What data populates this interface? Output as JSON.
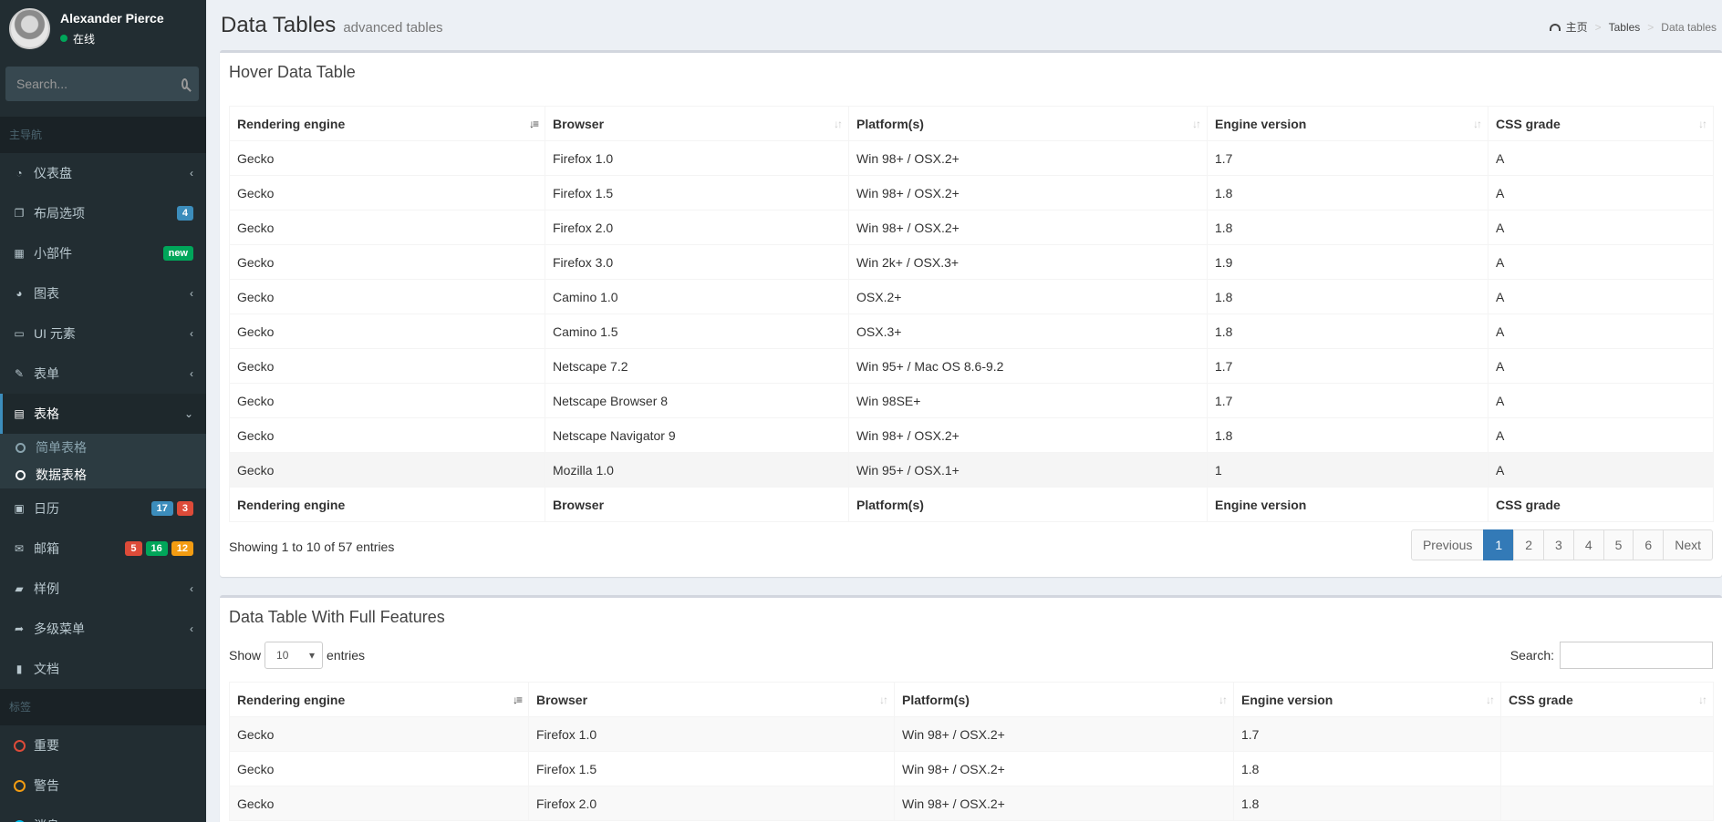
{
  "user": {
    "name": "Alexander Pierce",
    "status": "在线"
  },
  "sidebar": {
    "search_placeholder": "Search...",
    "header_main": "主导航",
    "header_labels": "标签",
    "items": [
      {
        "label": "仪表盘",
        "icon": "dashboard-icon"
      },
      {
        "label": "布局选项",
        "icon": "files-icon",
        "badges": [
          "4"
        ]
      },
      {
        "label": "小部件",
        "icon": "grid-icon",
        "badges": [
          "new"
        ]
      },
      {
        "label": "图表",
        "icon": "pie-chart-icon"
      },
      {
        "label": "UI 元素",
        "icon": "laptop-icon"
      },
      {
        "label": "表单",
        "icon": "edit-icon"
      },
      {
        "label": "表格",
        "icon": "table-icon"
      },
      {
        "label": "日历",
        "icon": "calendar-icon",
        "badges": [
          "17",
          "3"
        ]
      },
      {
        "label": "邮箱",
        "icon": "envelope-icon",
        "badges": [
          "5",
          "16",
          "12"
        ]
      },
      {
        "label": "样例",
        "icon": "folder-icon"
      },
      {
        "label": "多级菜单",
        "icon": "share-icon"
      },
      {
        "label": "文档",
        "icon": "book-icon"
      }
    ],
    "submenu": [
      "简单表格",
      "数据表格"
    ],
    "labels": [
      {
        "label": "重要",
        "color": "#dd4b39"
      },
      {
        "label": "警告",
        "color": "#f39c12"
      },
      {
        "label": "消息",
        "color": "#00c0ef"
      }
    ]
  },
  "header": {
    "title": "Data Tables",
    "subtitle": "advanced tables"
  },
  "breadcrumb": {
    "home": "主页",
    "tables": "Tables",
    "current": "Data tables"
  },
  "columns": [
    "Rendering engine",
    "Browser",
    "Platform(s)",
    "Engine version",
    "CSS grade"
  ],
  "table1": {
    "title": "Hover Data Table",
    "rows": [
      [
        "Gecko",
        "Firefox 1.0",
        "Win 98+ / OSX.2+",
        "1.7",
        "A"
      ],
      [
        "Gecko",
        "Firefox 1.5",
        "Win 98+ / OSX.2+",
        "1.8",
        "A"
      ],
      [
        "Gecko",
        "Firefox 2.0",
        "Win 98+ / OSX.2+",
        "1.8",
        "A"
      ],
      [
        "Gecko",
        "Firefox 3.0",
        "Win 2k+ / OSX.3+",
        "1.9",
        "A"
      ],
      [
        "Gecko",
        "Camino 1.0",
        "OSX.2+",
        "1.8",
        "A"
      ],
      [
        "Gecko",
        "Camino 1.5",
        "OSX.3+",
        "1.8",
        "A"
      ],
      [
        "Gecko",
        "Netscape 7.2",
        "Win 95+ / Mac OS 8.6-9.2",
        "1.7",
        "A"
      ],
      [
        "Gecko",
        "Netscape Browser 8",
        "Win 98SE+",
        "1.7",
        "A"
      ],
      [
        "Gecko",
        "Netscape Navigator 9",
        "Win 98+ / OSX.2+",
        "1.8",
        "A"
      ],
      [
        "Gecko",
        "Mozilla 1.0",
        "Win 95+ / OSX.1+",
        "1",
        "A"
      ]
    ],
    "info": "Showing 1 to 10 of 57 entries",
    "pagination": [
      "Previous",
      "1",
      "2",
      "3",
      "4",
      "5",
      "6",
      "Next"
    ]
  },
  "table2": {
    "title": "Data Table With Full Features",
    "show_label": "Show",
    "entries_label": "entries",
    "length_value": "10",
    "search_label": "Search:",
    "rows": [
      [
        "Gecko",
        "Firefox 1.0",
        "Win 98+ / OSX.2+",
        "1.7",
        ""
      ],
      [
        "Gecko",
        "Firefox 1.5",
        "Win 98+ / OSX.2+",
        "1.8",
        ""
      ],
      [
        "Gecko",
        "Firefox 2.0",
        "Win 98+ / OSX.2+",
        "1.8",
        ""
      ]
    ]
  }
}
